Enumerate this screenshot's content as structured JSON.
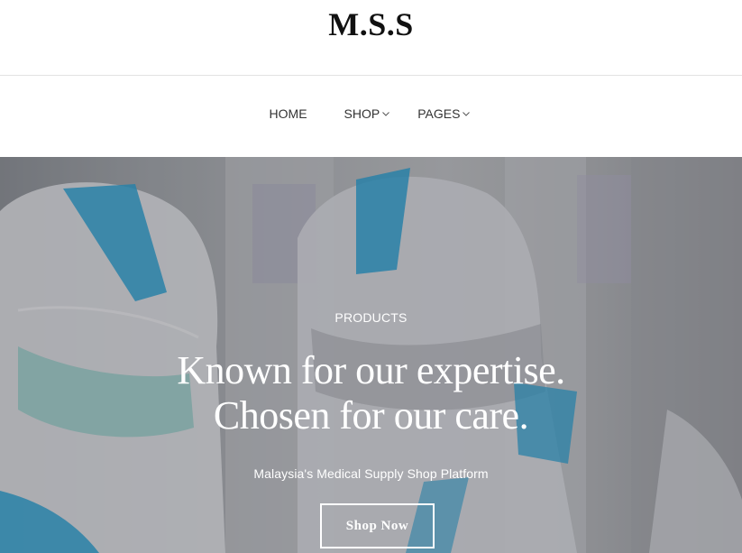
{
  "header": {
    "logo_text": "M.S.S"
  },
  "nav": {
    "items": [
      {
        "label": "HOME",
        "has_dropdown": false
      },
      {
        "label": "SHOP",
        "has_dropdown": true
      },
      {
        "label": "PAGES",
        "has_dropdown": true
      }
    ]
  },
  "hero": {
    "eyebrow": "PRODUCTS",
    "headline_line1": "Known for our expertise.",
    "headline_line2": "Chosen for our care.",
    "subheading": "Malaysia's Medical Supply Shop Platform",
    "cta_label": "Shop Now"
  },
  "colors": {
    "background": "#ffffff",
    "hero_text": "#ffffff",
    "nav_text": "#333333",
    "ppe_blue_tape": "#2a9fd0"
  }
}
